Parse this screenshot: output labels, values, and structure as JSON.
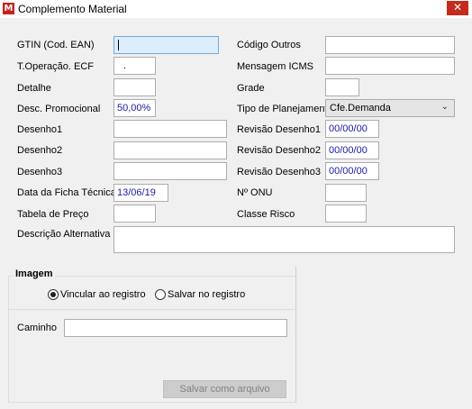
{
  "window": {
    "title": "Complemento Material",
    "close_glyph": "✕",
    "icon_glyph": "Ⓜ"
  },
  "fields": {
    "gtin": {
      "label": "GTIN (Cod. EAN)",
      "value": ""
    },
    "codigo_outros": {
      "label": "Código Outros",
      "value": ""
    },
    "t_operacao": {
      "label": "T.Operação. ECF",
      "value": "."
    },
    "mensagem_icms": {
      "label": "Mensagem ICMS",
      "value": ""
    },
    "detalhe": {
      "label": "Detalhe",
      "value": ""
    },
    "grade": {
      "label": "Grade",
      "value": ""
    },
    "desc_promocional": {
      "label": "Desc. Promocional",
      "value": "50,00%"
    },
    "tipo_planejamento": {
      "label": "Tipo de Planejamento",
      "value": "Cfe.Demanda"
    },
    "desenho1": {
      "label": "Desenho1",
      "value": ""
    },
    "revisao_desenho1": {
      "label": "Revisão Desenho1",
      "value": "00/00/00"
    },
    "desenho2": {
      "label": "Desenho2",
      "value": ""
    },
    "revisao_desenho2": {
      "label": "Revisão Desenho2",
      "value": "00/00/00"
    },
    "desenho3": {
      "label": "Desenho3",
      "value": ""
    },
    "revisao_desenho3": {
      "label": "Revisão Desenho3",
      "value": "00/00/00"
    },
    "data_ficha_tecnica": {
      "label": "Data da Ficha Técnica",
      "value": "13/06/19"
    },
    "n_onu": {
      "label": "Nº ONU",
      "value": ""
    },
    "tabela_preco": {
      "label": "Tabela de Preço",
      "value": ""
    },
    "classe_risco": {
      "label": "Classe Risco",
      "value": ""
    },
    "descricao_alternativa": {
      "label": "Descrição Alternativa",
      "value": ""
    }
  },
  "imagem": {
    "title": "Imagem",
    "radio_vincular": "Vincular ao registro",
    "radio_salvar": "Salvar no registro",
    "selected": "vincular",
    "caminho_label": "Caminho",
    "caminho_value": "",
    "save_button": "Salvar como arquivo"
  },
  "icons": {
    "app": "app-logo-icon",
    "close": "close-icon",
    "dropdown": "chevron-down-icon"
  }
}
